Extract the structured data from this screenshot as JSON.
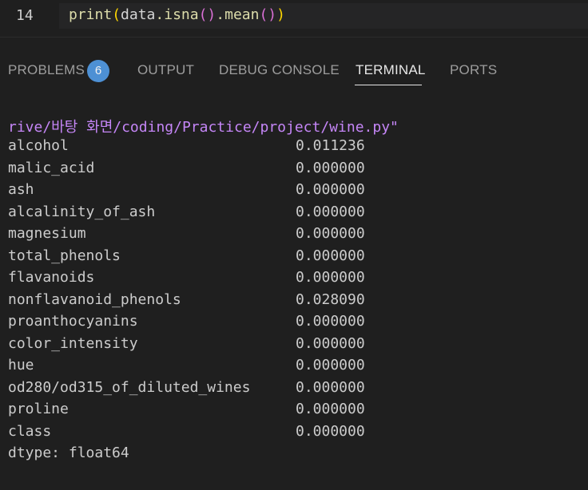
{
  "editor": {
    "line_number": "14",
    "code": {
      "fn": "print",
      "open1": "(",
      "obj": "data",
      "call1": ".isna",
      "parens1": "()",
      "call2": ".mean",
      "parens2": "()",
      "close1": ")"
    }
  },
  "panel": {
    "tabs": {
      "problems": "PROBLEMS",
      "problems_count": "6",
      "output": "OUTPUT",
      "debug_console": "DEBUG CONSOLE",
      "terminal": "TERMINAL",
      "ports": "PORTS"
    },
    "active_tab": "TERMINAL"
  },
  "terminal": {
    "path": "rive/바탕 화면/coding/Practice/project/wine.py\"",
    "rows": [
      {
        "name": "alcohol",
        "value": "0.011236"
      },
      {
        "name": "malic_acid",
        "value": "0.000000"
      },
      {
        "name": "ash",
        "value": "0.000000"
      },
      {
        "name": "alcalinity_of_ash",
        "value": "0.000000"
      },
      {
        "name": "magnesium",
        "value": "0.000000"
      },
      {
        "name": "total_phenols",
        "value": "0.000000"
      },
      {
        "name": "flavanoids",
        "value": "0.000000"
      },
      {
        "name": "nonflavanoid_phenols",
        "value": "0.028090"
      },
      {
        "name": "proanthocyanins",
        "value": "0.000000"
      },
      {
        "name": "color_intensity",
        "value": "0.000000"
      },
      {
        "name": "hue",
        "value": "0.000000"
      },
      {
        "name": "od280/od315_of_diluted_wines",
        "value": "0.000000"
      },
      {
        "name": "proline",
        "value": "0.000000"
      },
      {
        "name": "class",
        "value": "0.000000"
      }
    ],
    "dtype": "dtype: float64"
  },
  "colors": {
    "background": "#1f1f1f",
    "path_purple": "#c586f7",
    "badge_blue": "#4d90d4",
    "function_yellow": "#dcdcaa"
  }
}
